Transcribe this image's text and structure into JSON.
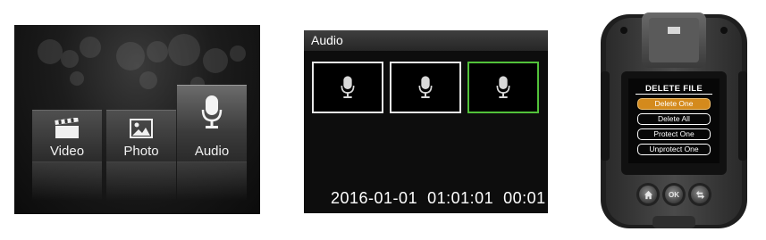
{
  "menu": {
    "items": [
      {
        "label": "Video",
        "icon": "video-clapper-icon",
        "selected": false
      },
      {
        "label": "Photo",
        "icon": "photo-icon",
        "selected": false
      },
      {
        "label": "Audio",
        "icon": "microphone-icon",
        "selected": true
      }
    ]
  },
  "audio_list": {
    "title": "Audio",
    "files": [
      {
        "icon": "microphone-icon",
        "selected": false
      },
      {
        "icon": "microphone-icon",
        "selected": false
      },
      {
        "icon": "microphone-icon",
        "selected": true
      }
    ],
    "timestamp": "2016-01-01  01:01:01  00:01",
    "selected_color": "#52c23a"
  },
  "device": {
    "dialog_title": "DELETE FILE",
    "options": [
      {
        "label": "Delete One",
        "selected": true
      },
      {
        "label": "Delete All",
        "selected": false
      },
      {
        "label": "Protect One",
        "selected": false
      },
      {
        "label": "Unprotect One",
        "selected": false
      }
    ],
    "buttons": {
      "home_icon": "home-icon",
      "ok_label": "OK",
      "back_icon": "back-icon"
    },
    "highlight_color": "#d48a1c"
  }
}
